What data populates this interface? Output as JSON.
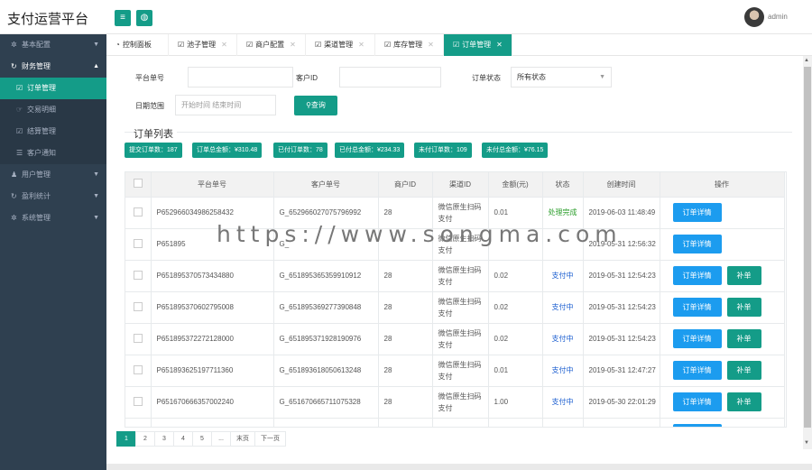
{
  "app": {
    "title": "支付运营平台",
    "user": "admin"
  },
  "sidebar": {
    "items": [
      {
        "icon": "gear-icon",
        "label": "基本配置",
        "arrow": "▼"
      },
      {
        "icon": "refresh-icon",
        "label": "财务管理",
        "arrow": "▲"
      },
      {
        "icon": "user-icon",
        "label": "用户管理",
        "arrow": "▼"
      },
      {
        "icon": "refresh-icon",
        "label": "盈利统计",
        "arrow": "▼"
      },
      {
        "icon": "gear-icon",
        "label": "系统管理",
        "arrow": "▼"
      }
    ],
    "sub": [
      {
        "icon": "checkbox-icon",
        "label": "订单管理"
      },
      {
        "icon": "hand-icon",
        "label": "交易明细"
      },
      {
        "icon": "checkbox-icon",
        "label": "结算管理"
      },
      {
        "icon": "list-icon",
        "label": "客户通知"
      }
    ]
  },
  "tabs": [
    {
      "icon": "dashboard-icon",
      "label": "控制面板"
    },
    {
      "icon": "checkbox-icon",
      "label": "池子管理",
      "close": "✕"
    },
    {
      "icon": "checkbox-icon",
      "label": "商户配置",
      "close": "✕"
    },
    {
      "icon": "checkbox-icon",
      "label": "渠道管理",
      "close": "✕"
    },
    {
      "icon": "checkbox-icon",
      "label": "库存管理",
      "close": "✕"
    },
    {
      "icon": "checkbox-icon",
      "label": "订单管理",
      "close": "✕"
    }
  ],
  "filters": {
    "order_no_label": "平台单号",
    "customer_id_label": "客户ID",
    "status_label": "订单状态",
    "status_value": "所有状态",
    "date_label": "日期范围",
    "date_placeholder": "开始时间 结束时间",
    "query_label": "查询"
  },
  "section_title": "订单列表",
  "badges": [
    "提交订单数：187",
    "订单总金额：¥310.48",
    "已付订单数：78",
    "已付总金额：¥234.33",
    "未付订单数：109",
    "未付总金额：¥76.15"
  ],
  "table": {
    "headers": [
      "平台单号",
      "客户单号",
      "商户ID",
      "渠道ID",
      "金额(元)",
      "状态",
      "创建时间",
      "操作"
    ],
    "detail_label": "订单详情",
    "fill_label": "补单",
    "rows": [
      {
        "order": "P652966034986258432",
        "cust": "G_652966027075796992",
        "mid": "28",
        "channel": "微信原生扫码支付",
        "amount": "0.01",
        "status": "处理完成",
        "status_type": "ok",
        "time": "2019-06-03 11:48:49",
        "fill": false
      },
      {
        "order": "P651895",
        "cust": "G_",
        "mid": "",
        "channel": "微信原生扫码支付",
        "amount": "",
        "status": "",
        "status_type": "ok",
        "time": "2019-05-31 12:56:32",
        "fill": false
      },
      {
        "order": "P651895370573434880",
        "cust": "G_651895365359910912",
        "mid": "28",
        "channel": "微信原生扫码支付",
        "amount": "0.02",
        "status": "支付中",
        "status_type": "pay",
        "time": "2019-05-31 12:54:23",
        "fill": true
      },
      {
        "order": "P651895370602795008",
        "cust": "G_651895369277390848",
        "mid": "28",
        "channel": "微信原生扫码支付",
        "amount": "0.02",
        "status": "支付中",
        "status_type": "pay",
        "time": "2019-05-31 12:54:23",
        "fill": true
      },
      {
        "order": "P651895372272128000",
        "cust": "G_651895371928190976",
        "mid": "28",
        "channel": "微信原生扫码支付",
        "amount": "0.02",
        "status": "支付中",
        "status_type": "pay",
        "time": "2019-05-31 12:54:23",
        "fill": true
      },
      {
        "order": "P651893625197711360",
        "cust": "G_651893618050613248",
        "mid": "28",
        "channel": "微信原生扫码支付",
        "amount": "0.01",
        "status": "支付中",
        "status_type": "pay",
        "time": "2019-05-31 12:47:27",
        "fill": true
      },
      {
        "order": "P651670666357002240",
        "cust": "G_651670665711075328",
        "mid": "28",
        "channel": "微信原生扫码支付",
        "amount": "1.00",
        "status": "支付中",
        "status_type": "pay",
        "time": "2019-05-30 22:01:29",
        "fill": true
      },
      {
        "order": "",
        "cust": "",
        "mid": "",
        "channel": "微信原生扫",
        "amount": "",
        "status": "",
        "status_type": "pay",
        "time": "2019-05-30",
        "fill": false
      }
    ]
  },
  "pager": [
    "1",
    "2",
    "3",
    "4",
    "5",
    "...",
    "末页",
    "下一页"
  ],
  "watermark": "https://www.songma.com",
  "colors": {
    "accent": "#149c88",
    "sidebar": "#2f4050",
    "detail": "#1c9cef"
  }
}
